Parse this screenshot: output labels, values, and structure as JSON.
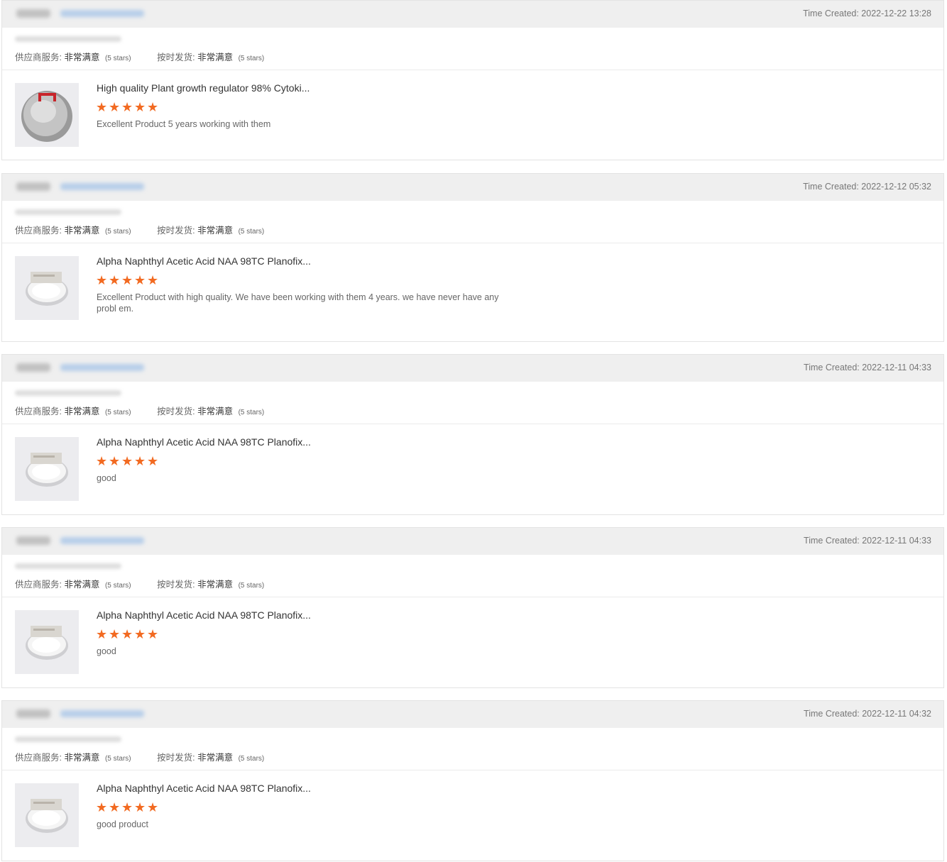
{
  "reviews": [
    {
      "time_created": "Time Created: 2022-12-22 13:28",
      "supplier_service_label": "供应商服务:",
      "supplier_service_value": "非常满意",
      "supplier_service_stars": "(5 stars)",
      "on_time_label": "按时发货:",
      "on_time_value": "非常满意",
      "on_time_stars": "(5 stars)",
      "product_title": "High quality Plant growth regulator 98% Cytoki...",
      "rating": 5,
      "review_text": "Excellent Product 5 years working with them",
      "thumb_icon": "powder-bag-thumbnail"
    },
    {
      "time_created": "Time Created: 2022-12-12 05:32",
      "supplier_service_label": "供应商服务:",
      "supplier_service_value": "非常满意",
      "supplier_service_stars": "(5 stars)",
      "on_time_label": "按时发货:",
      "on_time_value": "非常满意",
      "on_time_stars": "(5 stars)",
      "product_title": "Alpha Naphthyl Acetic Acid NAA 98TC Planofix...",
      "rating": 5,
      "review_text": "Excellent Product with high quality. We have been working with them 4 years. we have never have any probl em.",
      "thumb_icon": "petri-dish-thumbnail"
    },
    {
      "time_created": "Time Created: 2022-12-11 04:33",
      "supplier_service_label": "供应商服务:",
      "supplier_service_value": "非常满意",
      "supplier_service_stars": "(5 stars)",
      "on_time_label": "按时发货:",
      "on_time_value": "非常满意",
      "on_time_stars": "(5 stars)",
      "product_title": "Alpha Naphthyl Acetic Acid NAA 98TC Planofix...",
      "rating": 5,
      "review_text": "good",
      "thumb_icon": "petri-dish-thumbnail"
    },
    {
      "time_created": "Time Created: 2022-12-11 04:33",
      "supplier_service_label": "供应商服务:",
      "supplier_service_value": "非常满意",
      "supplier_service_stars": "(5 stars)",
      "on_time_label": "按时发货:",
      "on_time_value": "非常满意",
      "on_time_stars": "(5 stars)",
      "product_title": "Alpha Naphthyl Acetic Acid NAA 98TC Planofix...",
      "rating": 5,
      "review_text": "good",
      "thumb_icon": "petri-dish-thumbnail"
    },
    {
      "time_created": "Time Created: 2022-12-11 04:32",
      "supplier_service_label": "供应商服务:",
      "supplier_service_value": "非常满意",
      "supplier_service_stars": "(5 stars)",
      "on_time_label": "按时发货:",
      "on_time_value": "非常满意",
      "on_time_stars": "(5 stars)",
      "product_title": "Alpha Naphthyl Acetic Acid NAA 98TC Planofix...",
      "rating": 5,
      "review_text": "good product",
      "thumb_icon": "petri-dish-thumbnail"
    }
  ],
  "colors": {
    "star": "#f26a21",
    "header_bg": "#efefef",
    "border": "#e3e3e3"
  },
  "icons": {
    "star": "star-icon"
  }
}
